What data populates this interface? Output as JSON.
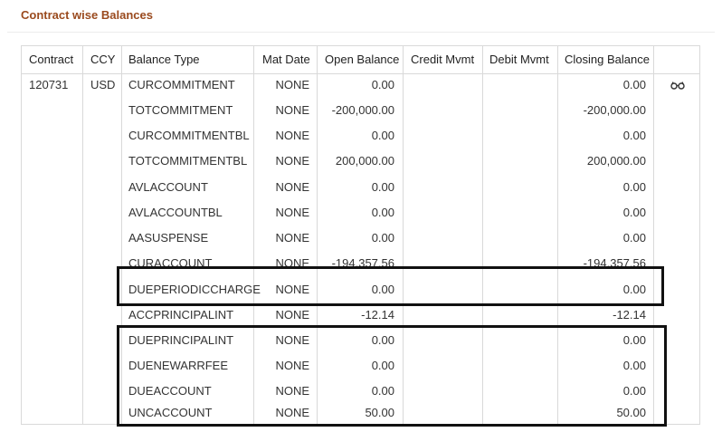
{
  "section": {
    "title": "Contract wise Balances"
  },
  "table": {
    "headers": {
      "contract": "Contract",
      "ccy": "CCY",
      "balance_type": "Balance Type",
      "mat_date": "Mat Date",
      "open_balance": "Open Balance",
      "credit_mvmt": "Credit Mvmt",
      "debit_mvmt": "Debit Mvmt",
      "closing_balance": "Closing Balance"
    },
    "contract": "120731",
    "ccy": "USD",
    "rows": [
      {
        "balance_type": "CURCOMMITMENT",
        "mat_date": "NONE",
        "open_balance": "0.00",
        "closing_balance": "0.00"
      },
      {
        "balance_type": "TOTCOMMITMENT",
        "mat_date": "NONE",
        "open_balance": "-200,000.00",
        "closing_balance": "-200,000.00"
      },
      {
        "balance_type": "CURCOMMITMENTBL",
        "mat_date": "NONE",
        "open_balance": "0.00",
        "closing_balance": "0.00"
      },
      {
        "balance_type": "TOTCOMMITMENTBL",
        "mat_date": "NONE",
        "open_balance": "200,000.00",
        "closing_balance": "200,000.00"
      },
      {
        "balance_type": "AVLACCOUNT",
        "mat_date": "NONE",
        "open_balance": "0.00",
        "closing_balance": "0.00"
      },
      {
        "balance_type": "AVLACCOUNTBL",
        "mat_date": "NONE",
        "open_balance": "0.00",
        "closing_balance": "0.00"
      },
      {
        "balance_type": "AASUSPENSE",
        "mat_date": "NONE",
        "open_balance": "0.00",
        "closing_balance": "0.00"
      },
      {
        "balance_type": "CURACCOUNT",
        "mat_date": "NONE",
        "open_balance": "-194,357.56",
        "closing_balance": "-194,357.56"
      },
      {
        "balance_type": "DUEPERIODICCHARGE",
        "mat_date": "NONE",
        "open_balance": "0.00",
        "closing_balance": "0.00"
      },
      {
        "balance_type": "ACCPRINCIPALINT",
        "mat_date": "NONE",
        "open_balance": "-12.14",
        "closing_balance": "-12.14"
      },
      {
        "balance_type": "DUEPRINCIPALINT",
        "mat_date": "NONE",
        "open_balance": "0.00",
        "closing_balance": "0.00"
      },
      {
        "balance_type": "DUENEWARRFEE",
        "mat_date": "NONE",
        "open_balance": "0.00",
        "closing_balance": "0.00"
      },
      {
        "balance_type": "DUEACCOUNT",
        "mat_date": "NONE",
        "open_balance": "0.00",
        "closing_balance": "0.00"
      },
      {
        "balance_type": "UNCACCOUNT",
        "mat_date": "NONE",
        "open_balance": "50.00",
        "closing_balance": "50.00"
      }
    ]
  },
  "icons": {
    "view": "glasses-icon"
  }
}
